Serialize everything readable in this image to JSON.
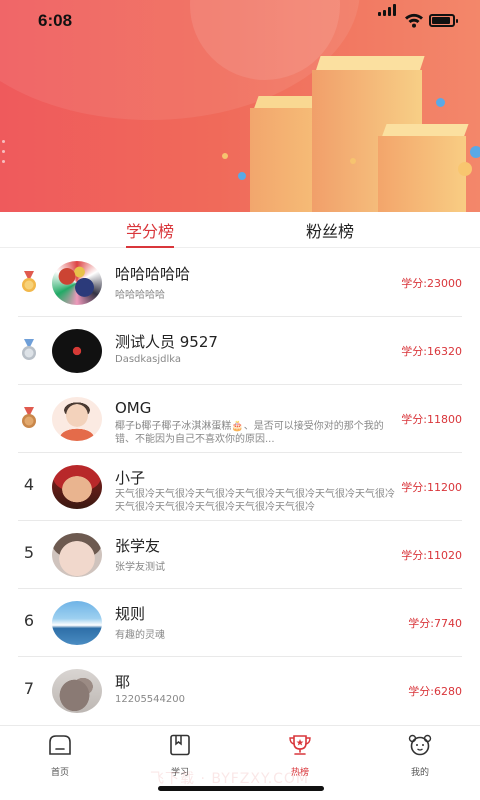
{
  "status_bar": {
    "time": "6:08"
  },
  "tabs": [
    {
      "label": "学分榜",
      "active": true
    },
    {
      "label": "粉丝榜",
      "active": false
    }
  ],
  "ranking": [
    {
      "rank": "1",
      "medal": "gold-medal-icon",
      "name": "哈哈哈哈哈",
      "sub": "哈哈哈哈哈",
      "score": "学分:23000"
    },
    {
      "rank": "2",
      "medal": "silver-medal-icon",
      "name": "测试人员 9527",
      "sub": "Dasdkasjdlka",
      "score": "学分:16320"
    },
    {
      "rank": "3",
      "medal": "bronze-medal-icon",
      "name": "OMG",
      "sub": "椰子b椰子椰子冰淇淋蛋糕🎂、是否可以接受你对的那个我的错、不能因为自己不喜欢你的原因...",
      "score": "学分:11800"
    },
    {
      "rank": "4",
      "name": "小子",
      "sub": "天气很冷天气很冷天气很冷天气很冷天气很冷天气很冷天气很冷天气很冷天气很冷天气很冷天气很冷天气很冷",
      "score": "学分:11200"
    },
    {
      "rank": "5",
      "name": "张学友",
      "sub": "张学友测试",
      "score": "学分:11020"
    },
    {
      "rank": "6",
      "name": "规则",
      "sub": "有趣的灵魂",
      "score": "学分:7740"
    },
    {
      "rank": "7",
      "name": "耶",
      "sub": "12205544200",
      "score": "学分:6280"
    }
  ],
  "bottom_nav": [
    {
      "label": "首页",
      "icon": "home-icon",
      "active": false
    },
    {
      "label": "学习",
      "icon": "book-icon",
      "active": false
    },
    {
      "label": "热榜",
      "icon": "trophy-icon",
      "active": true
    },
    {
      "label": "我的",
      "icon": "profile-face-icon",
      "active": false
    }
  ],
  "watermark": "飞下载 · BYFZXY.COM",
  "colors": {
    "accent": "#d9363b",
    "hero_start": "#ef5a5c",
    "hero_end": "#f3876a"
  }
}
